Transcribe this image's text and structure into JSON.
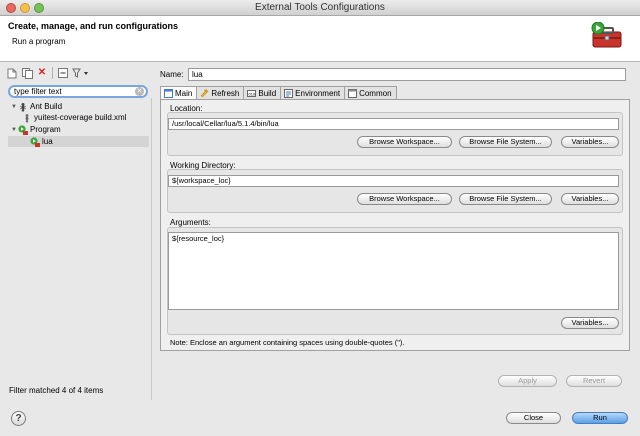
{
  "window": {
    "title": "External Tools Configurations"
  },
  "header": {
    "title": "Create, manage, and run configurations",
    "subtitle": "Run a program"
  },
  "left": {
    "filter_placeholder": "type filter text",
    "tree": {
      "ant_build": "Ant Build",
      "ant_child": "yuitest-coverage build.xml",
      "program": "Program",
      "program_child": "lua"
    },
    "status": "Filter matched 4 of 4 items"
  },
  "name": {
    "label": "Name:",
    "value": "lua"
  },
  "tabs": [
    "Main",
    "Refresh",
    "Build",
    "Environment",
    "Common"
  ],
  "location": {
    "label": "Location:",
    "value": "/usr/local/Cellar/lua/5.1.4/bin/lua"
  },
  "working_dir": {
    "label": "Working Directory:",
    "value": "${workspace_loc}"
  },
  "arguments": {
    "label": "Arguments:",
    "value": "${resource_loc}",
    "note": "Note: Enclose an argument containing spaces using double-quotes (\")."
  },
  "buttons": {
    "browse_workspace": "Browse Workspace...",
    "browse_file_system": "Browse File System...",
    "variables": "Variables...",
    "apply": "Apply",
    "revert": "Revert",
    "close": "Close",
    "run": "Run",
    "help": "?"
  },
  "colors": {
    "accent_blue": "#5aa0e8",
    "run_green": "#3aa53a",
    "toolbox_red": "#c8332b"
  }
}
